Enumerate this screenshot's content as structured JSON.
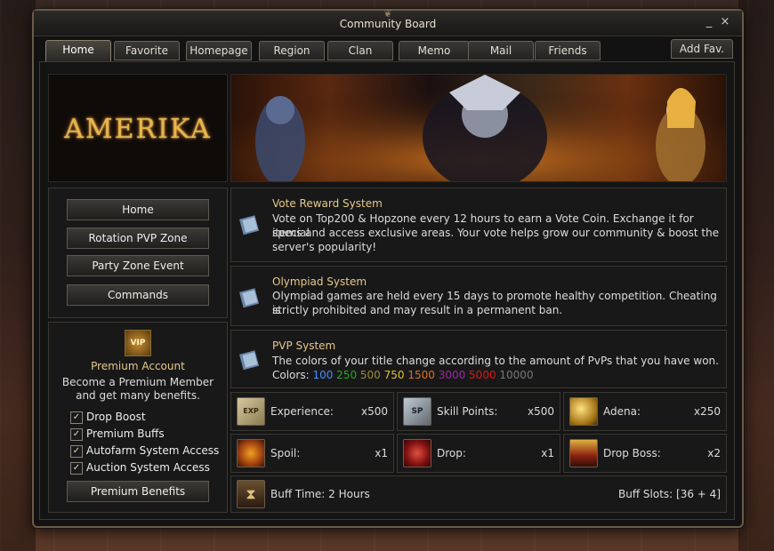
{
  "window": {
    "title": "Community Board",
    "minimize": "_",
    "close": "×"
  },
  "tabs": [
    {
      "label": "Home",
      "active": true
    },
    {
      "label": "Favorite"
    },
    {
      "label": "Homepage"
    },
    {
      "label": "Region"
    },
    {
      "label": "Clan"
    },
    {
      "label": "Memo"
    },
    {
      "label": "Mail"
    },
    {
      "label": "Friends"
    }
  ],
  "add_fav_label": "Add Fav.",
  "logo_text": "AMERIKA",
  "nav": [
    "Home",
    "Rotation PVP Zone",
    "Party Zone Event",
    "Commands"
  ],
  "premium": {
    "badge": "VIP",
    "title": "Premium Account",
    "description": "Become a Premium Member and get many benefits.",
    "benefits": [
      "Drop Boost",
      "Premium Buffs",
      "Autofarm System Access",
      "Auction System Access"
    ],
    "button": "Premium Benefits"
  },
  "news": [
    {
      "title": "Vote Reward System",
      "lines": [
        "Vote on Top200 & Hopzone every 12 hours to earn a Vote Coin. Exchange it for special",
        "items and access exclusive areas. Your vote helps grow our community & boost the",
        "server's popularity!"
      ]
    },
    {
      "title": "Olympiad System",
      "lines": [
        "Olympiad games are held every 15 days to promote healthy competition. Cheating is",
        "strictly prohibited and may result in a permanent ban."
      ]
    },
    {
      "title": "PVP System",
      "lines": [
        "The colors of your title change according to the amount of PvPs that you have won."
      ],
      "colors_label": "Colors:",
      "colors": [
        {
          "value": "100",
          "color": "#4a8cff"
        },
        {
          "value": "250",
          "color": "#22aa22"
        },
        {
          "value": "500",
          "color": "#9a8a3a"
        },
        {
          "value": "750",
          "color": "#e8c020"
        },
        {
          "value": "1500",
          "color": "#e07020"
        },
        {
          "value": "3000",
          "color": "#9a2aa0"
        },
        {
          "value": "5000",
          "color": "#d81818"
        },
        {
          "value": "10000",
          "color": "#777777"
        }
      ]
    }
  ],
  "rates": [
    {
      "label": "Experience:",
      "value": "x500",
      "icon": "exp-scroll-icon",
      "icon_text": "EXP"
    },
    {
      "label": "Skill Points:",
      "value": "x500",
      "icon": "sp-stone-icon",
      "icon_text": "SP"
    },
    {
      "label": "Adena:",
      "value": "x250",
      "icon": "adena-coins-icon",
      "icon_text": ""
    },
    {
      "label": "Spoil:",
      "value": "x1",
      "icon": "spoil-icon",
      "icon_text": ""
    },
    {
      "label": "Drop:",
      "value": "x1",
      "icon": "drop-icon",
      "icon_text": ""
    },
    {
      "label": "Drop Boss:",
      "value": "x2",
      "icon": "drop-boss-icon",
      "icon_text": ""
    }
  ],
  "buff": {
    "label": "Buff Time: 2 Hours",
    "slots": "Buff Slots: [36 + 4]"
  }
}
